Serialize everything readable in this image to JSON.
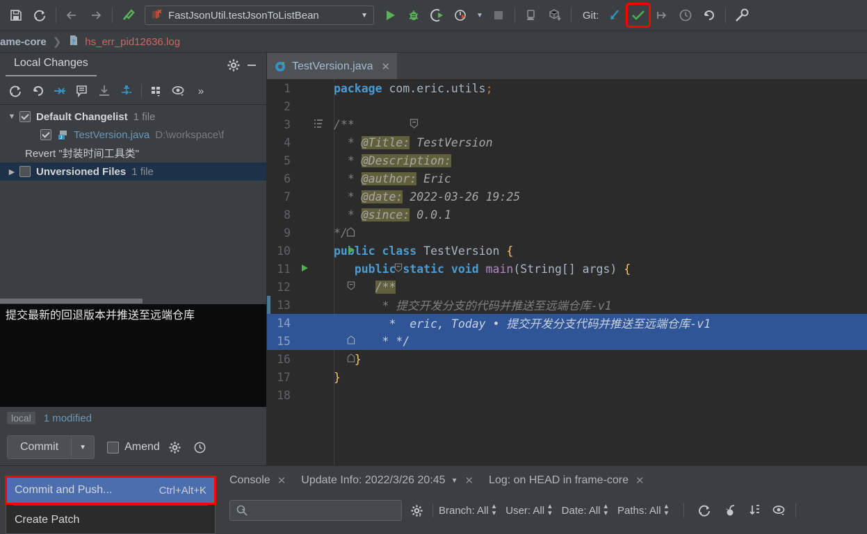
{
  "toolbar": {
    "icons_left": [
      "save-icon",
      "sync-icon",
      "back-arrow-icon",
      "forward-arrow-icon",
      "make-project-icon"
    ],
    "run_config": {
      "label": "FastJsonUtil.testJsonToListBean",
      "caret": "▼"
    },
    "icons_run": [
      "run-icon",
      "debug-icon",
      "run-coverage-icon",
      "profiler-icon",
      "stop-icon"
    ],
    "icons_android": [
      "avd-manager-icon",
      "sdk-manager-icon"
    ],
    "git_label": "Git:",
    "icons_git": [
      "update-project-icon",
      "commit-icon",
      "push-icon",
      "history-icon",
      "rollback-icon"
    ],
    "icons_right": [
      "search-everywhere-icon"
    ]
  },
  "breadcrumb": {
    "project": "ame-core",
    "separator": "❯",
    "file": "hs_err_pid12636.log"
  },
  "vcs": {
    "tab_label": "Local Changes",
    "head_icons": [
      "settings-gear-icon",
      "minimize-icon"
    ],
    "toolbar_icons": [
      "refresh-icon",
      "rollback-icon",
      "show-diff-icon",
      "edit-comment-icon",
      "shelve-icon",
      "merge-icon",
      "group-by-icon",
      "preview-eye-icon",
      "overflow-icon"
    ],
    "tree": [
      {
        "type": "changelist",
        "expander": "▼",
        "checked": true,
        "name": "Default Changelist",
        "count": "1 file"
      },
      {
        "type": "file",
        "checked": true,
        "name": "TestVersion.java",
        "path": "D:\\workspace\\f"
      },
      {
        "type": "note",
        "text": "Revert \"封装时间工具类\""
      },
      {
        "type": "group",
        "expander": "▶",
        "checked": false,
        "name": "Unversioned Files",
        "count": "1 file",
        "selected": true
      }
    ],
    "commit_message": "提交最新的回退版本并推送至远端仓库",
    "status": {
      "local_badge": "local",
      "modified": "1 modified"
    },
    "commit_button": "Commit",
    "commit_caret": "▼",
    "amend_label": "Amend",
    "amend_checked": false,
    "commit_icons": [
      "settings-gear-icon",
      "history-clock-icon"
    ],
    "menu": [
      {
        "label": "Commit and Push...",
        "shortcut": "Ctrl+Alt+K",
        "selected": true,
        "highlighted": true
      },
      {
        "label": "Create Patch",
        "shortcut": "",
        "selected": false,
        "highlighted": false
      }
    ]
  },
  "editor": {
    "tab": {
      "name": "TestVersion.java",
      "close": "✕",
      "icon": "java-class-icon"
    },
    "lines": [
      {
        "n": "1",
        "gutter": "",
        "marker": false
      },
      {
        "n": "2",
        "gutter": "",
        "marker": false
      },
      {
        "n": "3",
        "gutter": "fold-collapse",
        "marker": false
      },
      {
        "n": "4",
        "gutter": "",
        "marker": false
      },
      {
        "n": "5",
        "gutter": "",
        "marker": false
      },
      {
        "n": "6",
        "gutter": "",
        "marker": false
      },
      {
        "n": "7",
        "gutter": "",
        "marker": false
      },
      {
        "n": "8",
        "gutter": "",
        "marker": false
      },
      {
        "n": "9",
        "gutter": "fold-end",
        "marker": false
      },
      {
        "n": "10",
        "gutter": "run",
        "marker": false
      },
      {
        "n": "11",
        "gutter": "run-fold",
        "marker": false
      },
      {
        "n": "12",
        "gutter": "fold",
        "marker": false
      },
      {
        "n": "13",
        "gutter": "",
        "marker": true
      },
      {
        "n": "14",
        "gutter": "",
        "marker": false,
        "highlight": true
      },
      {
        "n": "15",
        "gutter": "fold-end",
        "marker": false,
        "highlight": true
      },
      {
        "n": "16",
        "gutter": "fold-end",
        "marker": false
      },
      {
        "n": "17",
        "gutter": "",
        "marker": false
      },
      {
        "n": "18",
        "gutter": "",
        "marker": false
      }
    ],
    "code": {
      "l1_kw": "package",
      "l1_rest": " com.eric.utils",
      "l1_semi": ";",
      "l3": "/**",
      "l4_tag": "@Title:",
      "l4_txt": " TestVersion",
      "l5_tag": "@Description:",
      "l5_txt": "",
      "l6_tag": "@author:",
      "l6_txt": " Eric",
      "l7_tag": "@date:",
      "l7_txt": " 2022-03-26 19:25",
      "l8_tag": "@since:",
      "l8_txt": " 0.0.1",
      "l9": "*/",
      "l10_kw1": "public",
      "l10_kw2": "class",
      "l10_name": " TestVersion ",
      "l10_brace": "{",
      "l11_kw1": "public",
      "l11_kw2": "static",
      "l11_kw3": "void",
      "l11_meth": "main",
      "l11_args": "(String[] args) ",
      "l11_brace": "{",
      "l12": "/**",
      "l13": "* 提交开发分支的代码并推送至远端仓库-v1",
      "l14": "*  eric, Today • 提交开发分支代码并推送至远端仓库-v1",
      "l15": "* */",
      "l16": "}",
      "l17": "}"
    }
  },
  "bottom": {
    "tabs": [
      {
        "label": "Console",
        "close": "✕",
        "caret": ""
      },
      {
        "label": "Update Info: 2022/3/26 20:45",
        "close": "✕",
        "caret": "▼"
      },
      {
        "label": "Log: on HEAD in frame-core",
        "close": "✕",
        "caret": ""
      }
    ],
    "search_placeholder": "",
    "search_icon": "search-icon",
    "gear_icon": "settings-gear-icon",
    "filters": [
      {
        "label": "Branch: All"
      },
      {
        "label": "User: All"
      },
      {
        "label": "Date: All"
      },
      {
        "label": "Paths: All"
      }
    ],
    "right_icons": [
      "refresh-icon",
      "cherry-pick-icon",
      "sort-icon",
      "show-details-eye-icon"
    ]
  }
}
